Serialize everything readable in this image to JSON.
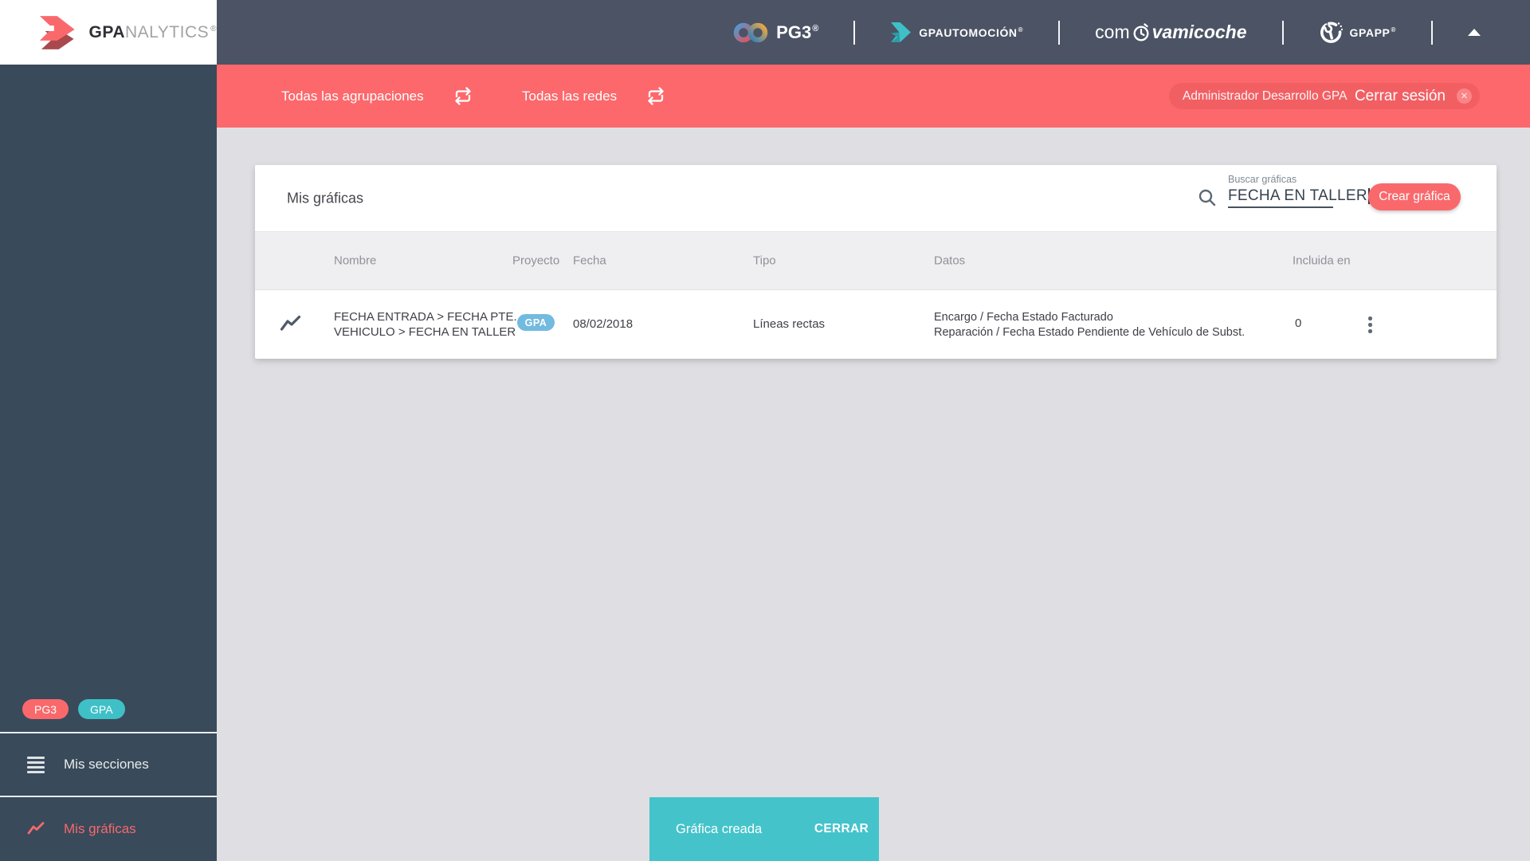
{
  "brand": {
    "bold": "GPA",
    "light": "NALYTICS",
    "reg": "®"
  },
  "topbar": {
    "pg3": {
      "label": "PG3",
      "reg": "®"
    },
    "gpautomocion": {
      "label": "GPAUTOMOCIÓN",
      "reg": "®"
    },
    "comprova": {
      "prefix": "com",
      "suffix": "vamicoche"
    },
    "gpapp": {
      "label": "GPAPP",
      "reg": "®"
    }
  },
  "filterbar": {
    "groupings": "Todas las agrupaciones",
    "networks": "Todas las redes",
    "user": "Administrador Desarrollo GPA",
    "logout": "Cerrar sesión",
    "logout_close": "✕"
  },
  "sidebar": {
    "badge_pg3": "PG3",
    "badge_gpa": "GPA",
    "sections_item": "Mis secciones",
    "charts_item": "Mis gráficas"
  },
  "main": {
    "title": "Mis gráficas",
    "search_label": "Buscar gráficas",
    "search_value": "FECHA EN TALLER",
    "create_button": "Crear gráfica",
    "table": {
      "headers": [
        "Nombre",
        "Proyecto",
        "Fecha",
        "Tipo",
        "Datos",
        "Incluida en"
      ],
      "rows": [
        {
          "name_line1": "FECHA ENTRADA > FECHA PTE.",
          "name_line2": "VEHICULO > FECHA EN TALLER",
          "project": "GPA",
          "date": "08/02/2018",
          "type": "Líneas rectas",
          "data_line1": "Encargo / Fecha Estado Facturado",
          "data_line2": "Reparación / Fecha Estado Pendiente de Vehículo de Subst.",
          "included_in": "0"
        }
      ]
    }
  },
  "toast": {
    "message": "Gráfica creada",
    "action": "CERRAR"
  },
  "colors": {
    "salmon": "#F9696C",
    "red_bar": "#FC686B",
    "teal": "#44C3CA",
    "badge_blue": "#72BADF",
    "topbar": "#4B5364",
    "sidebar": "#394A5A"
  }
}
